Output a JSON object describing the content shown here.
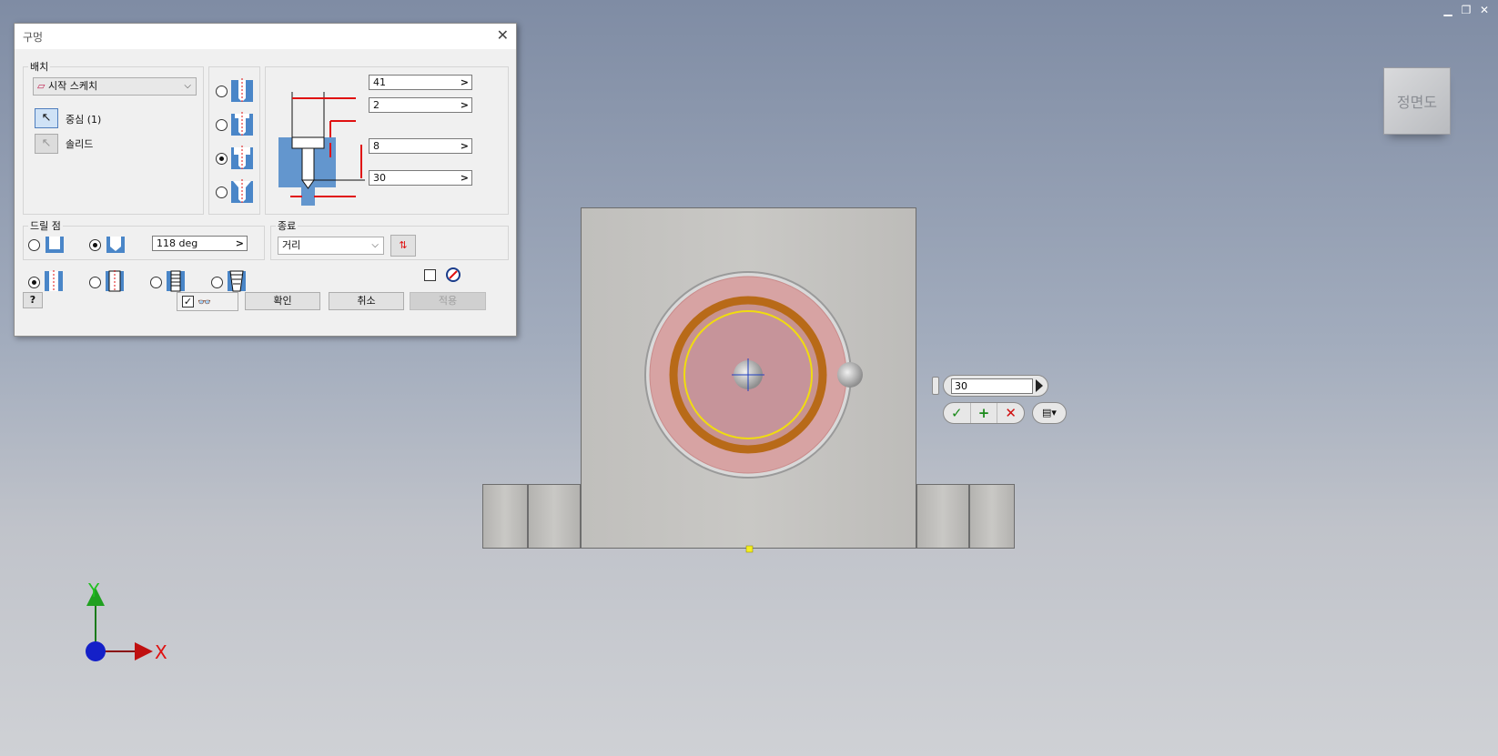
{
  "window": {
    "minimize": "▁",
    "restore": "❐",
    "close": "✕"
  },
  "viewcube": {
    "label": "정면도"
  },
  "axis": {
    "x_label": "X",
    "y_label": "Y"
  },
  "mini_toolbar": {
    "value": "30",
    "ok": "✓",
    "add": "+",
    "cancel": "✕",
    "menu": "▤▾"
  },
  "dialog": {
    "title": "구멍",
    "placement": {
      "label": "배치",
      "type": "시작 스케치",
      "center_label": "중심 (1)",
      "solid_label": "솔리드"
    },
    "dimensions": {
      "d1": "41",
      "d2": "2",
      "d3": "8",
      "d4": "30"
    },
    "drill_point": {
      "label": "드릴 점",
      "angle": "118 deg"
    },
    "termination": {
      "label": "종료",
      "value": "거리"
    },
    "buttons": {
      "ok": "확인",
      "cancel": "취소",
      "apply": "적용"
    },
    "colors": {
      "hatch": "#4a86c8",
      "dim_red": "#e01010"
    }
  }
}
